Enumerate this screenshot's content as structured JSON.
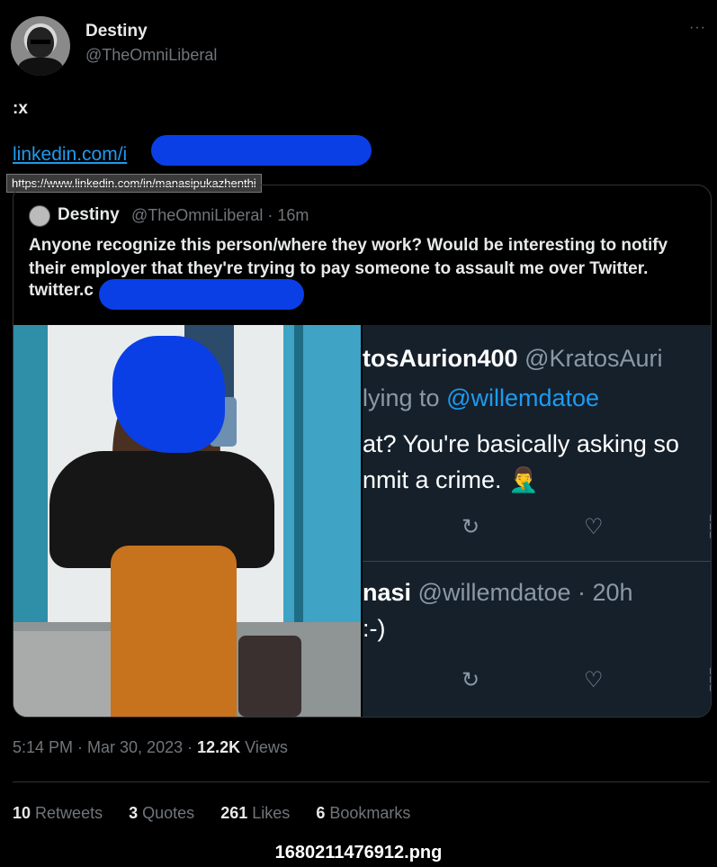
{
  "tweet": {
    "author_name": "Destiny",
    "author_handle": "@TheOmniLiberal",
    "more_icon": "···",
    "text": ":x",
    "link_text": "linkedin.com/i",
    "tooltip_url": "https://www.linkedin.com/in/manasipukazhenthi"
  },
  "quote": {
    "author_name": "Destiny",
    "author_handle": "@TheOmniLiberal",
    "time": "· 16m",
    "text": "Anyone recognize this person/where they work? Would be interesting to notify their employer that they're trying to pay someone to assault me over Twitter.",
    "link_text": "twitter.c"
  },
  "screenshot": {
    "reply1_name": "tosAurion400",
    "reply1_handle": "@KratosAuri",
    "replying_prefix": "lying to",
    "replying_mention": "@willemdatoe",
    "reply1_line1": "at? You're basically asking so",
    "reply1_line2": "nmit a crime. 🤦‍♂️",
    "retweet_icon": "↻",
    "like_icon": "♡",
    "views_icon": "┆",
    "reply2_name": "nasi",
    "reply2_handle": "@willemdatoe · 20h",
    "reply2_text": ":-)"
  },
  "footer": {
    "time": "5:14 PM · Mar 30, 2023 ·",
    "views_count": "12.2K",
    "views_label": "Views",
    "retweets_count": "10",
    "retweets_label": "Retweets",
    "quotes_count": "3",
    "quotes_label": "Quotes",
    "likes_count": "261",
    "likes_label": "Likes",
    "bookmarks_count": "6",
    "bookmarks_label": "Bookmarks"
  },
  "filename": "1680211476912.png",
  "colors": {
    "background": "#000000",
    "link": "#1d9bf0",
    "redaction": "#0a3fe6",
    "muted": "#71767b"
  }
}
